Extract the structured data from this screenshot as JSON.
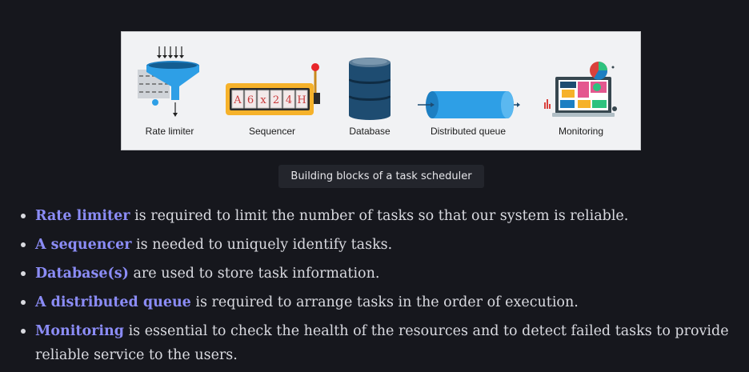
{
  "figure": {
    "blocks": [
      {
        "label": "Rate limiter",
        "icon": "funnel-icon"
      },
      {
        "label": "Sequencer",
        "icon": "sequencer-machine-icon",
        "display": [
          "A",
          "6",
          "x",
          "2",
          "4",
          "H"
        ]
      },
      {
        "label": "Database",
        "icon": "database-icon"
      },
      {
        "label": "Distributed queue",
        "icon": "queue-pipe-icon"
      },
      {
        "label": "Monitoring",
        "icon": "dashboard-monitor-icon"
      }
    ],
    "colors": {
      "blue": "#2e9fe6",
      "dark_blue": "#1e4c71",
      "yellow": "#f6b22a",
      "red": "#d9413c"
    }
  },
  "caption": "Building blocks of a task scheduler",
  "items": [
    {
      "term": "Rate limiter",
      "text": " is required to limit the number of tasks so that our system is reliable."
    },
    {
      "term": "A sequencer",
      "text": " is needed to uniquely identify tasks."
    },
    {
      "term": "Database(s)",
      "text": " are used to store task information."
    },
    {
      "term": "A distributed queue",
      "text": " is required to arrange tasks in the order of execution."
    },
    {
      "term": "Monitoring",
      "text": " is essential to check the health of the resources and to detect failed tasks to provide reliable service to the users."
    }
  ],
  "accent_color": "#8b8cf6"
}
